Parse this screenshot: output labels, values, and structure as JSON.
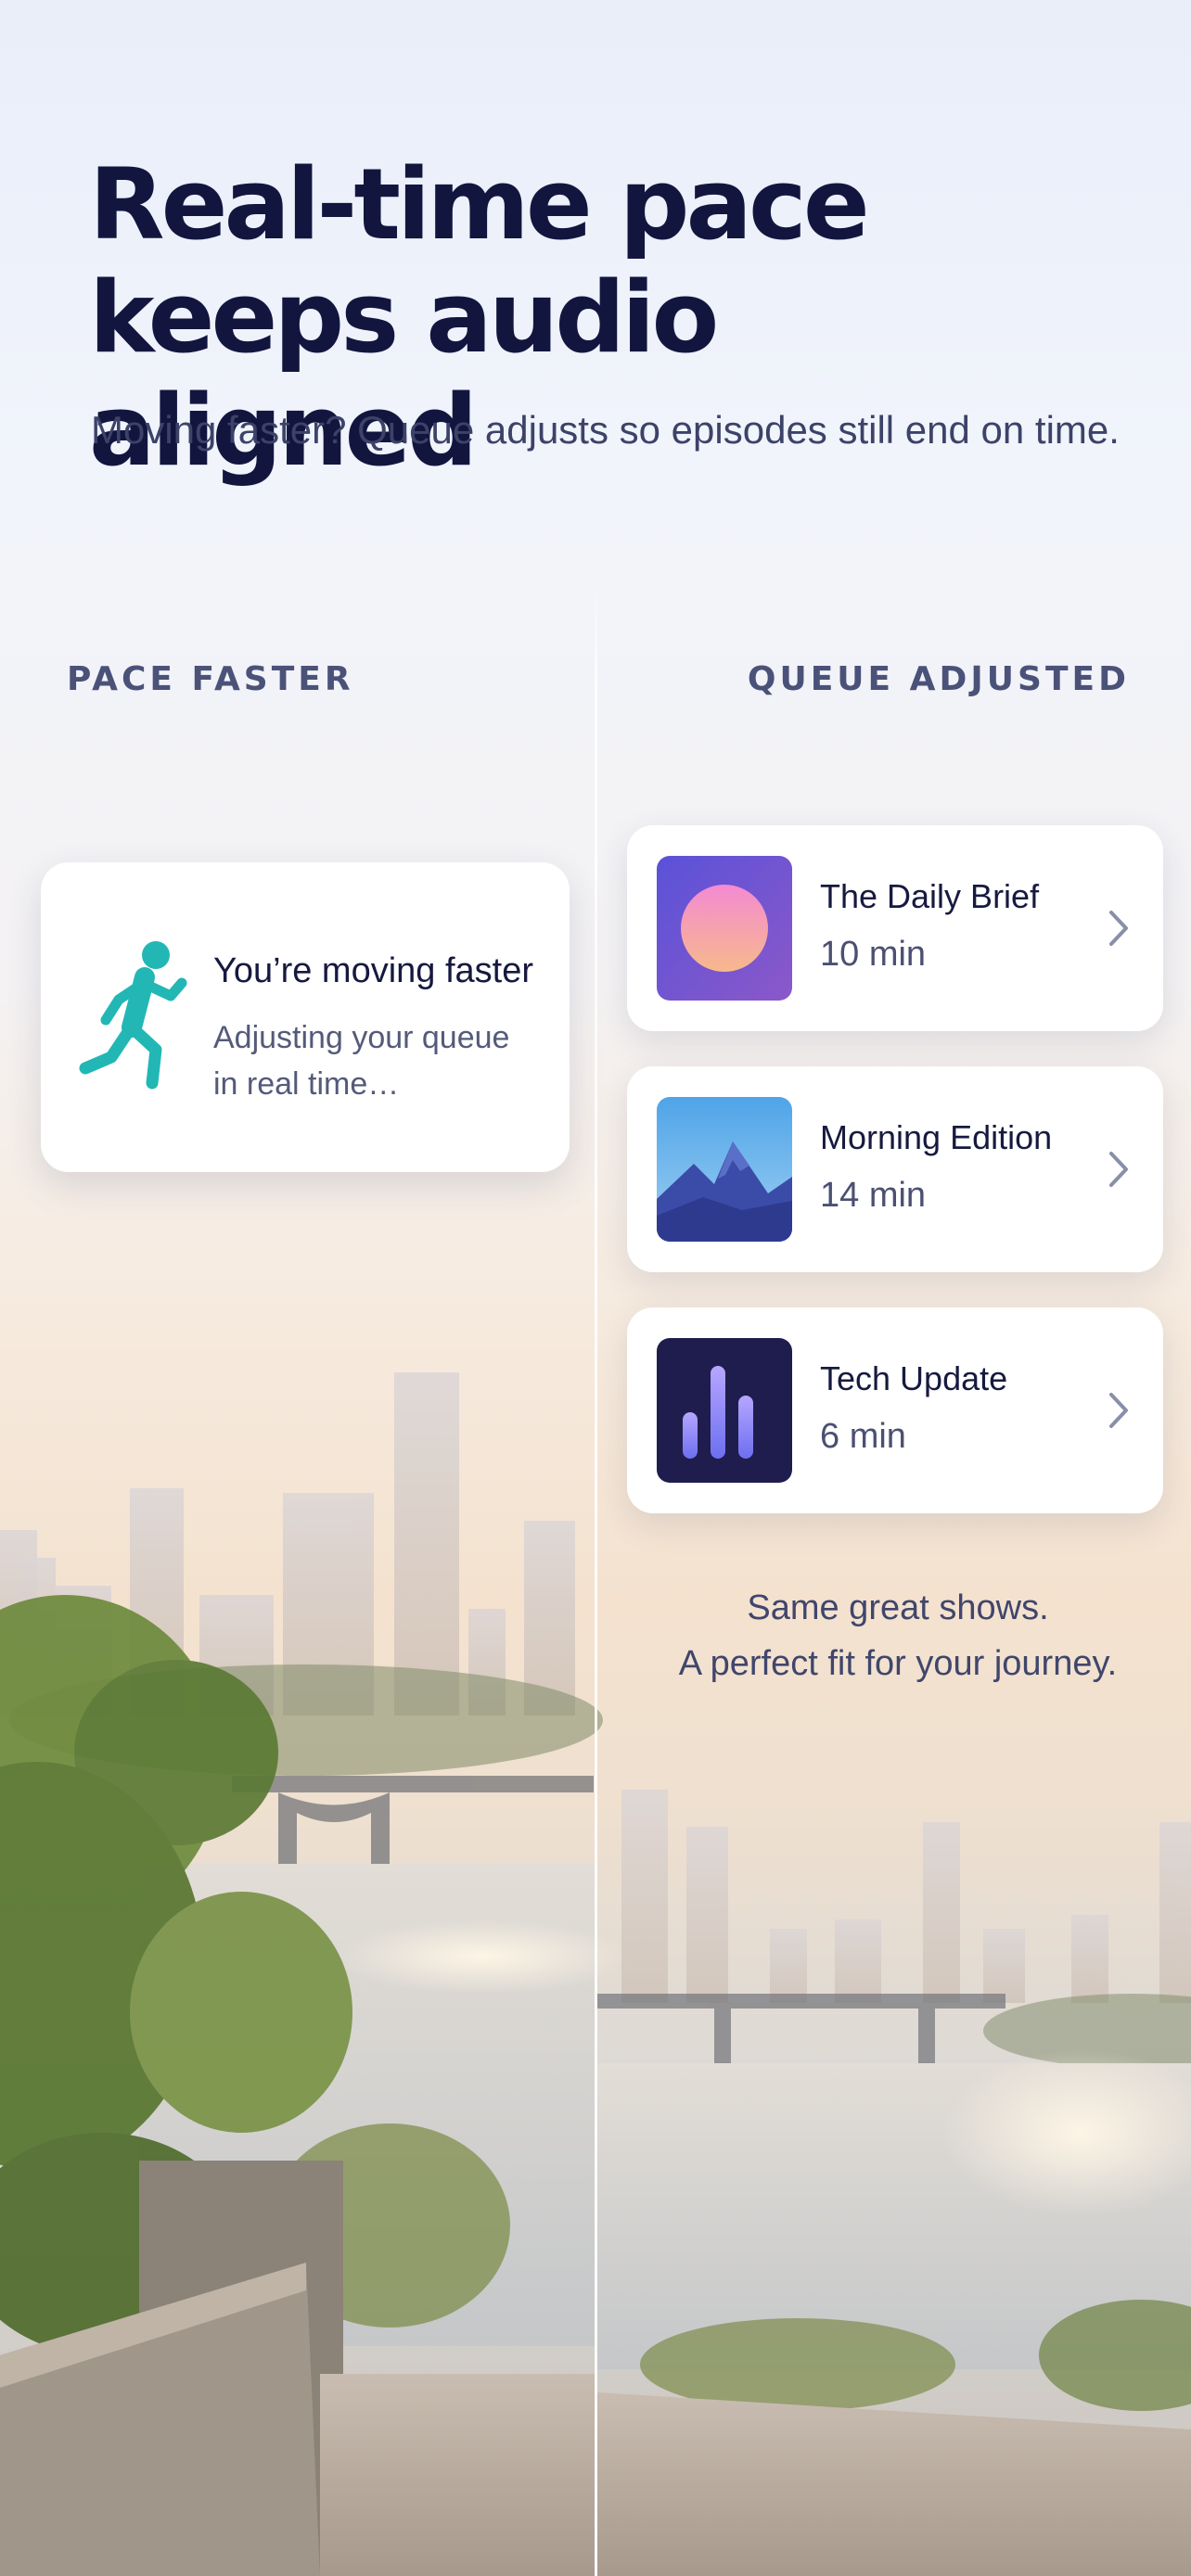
{
  "headline": {
    "line1": "Real-time pace",
    "line2": "keeps audio aligned",
    "subtitle": "Moving faster? Queue adjusts so episodes still end on time."
  },
  "left_panel": {
    "label": "PACE FASTER",
    "status_card": {
      "icon": "running-person-icon",
      "title": "You’re moving faster",
      "line1": "Adjusting your queue",
      "line2": "in real time…"
    }
  },
  "right_panel": {
    "label": "QUEUE ADJUSTED",
    "episodes": [
      {
        "title": "The Daily Brief",
        "duration": "10 min",
        "art": "sun-gradient-art"
      },
      {
        "title": "Morning Edition",
        "duration": "14 min",
        "art": "mountain-art"
      },
      {
        "title": "Tech Update",
        "duration": "6 min",
        "art": "equalizer-bars-art"
      }
    ],
    "tagline": {
      "line1": "Same great shows.",
      "line2": "A perfect fit for your journey."
    }
  },
  "colors": {
    "headline": "#12163f",
    "accent_teal": "#22b7b5",
    "card_bg": "#ffffff"
  }
}
